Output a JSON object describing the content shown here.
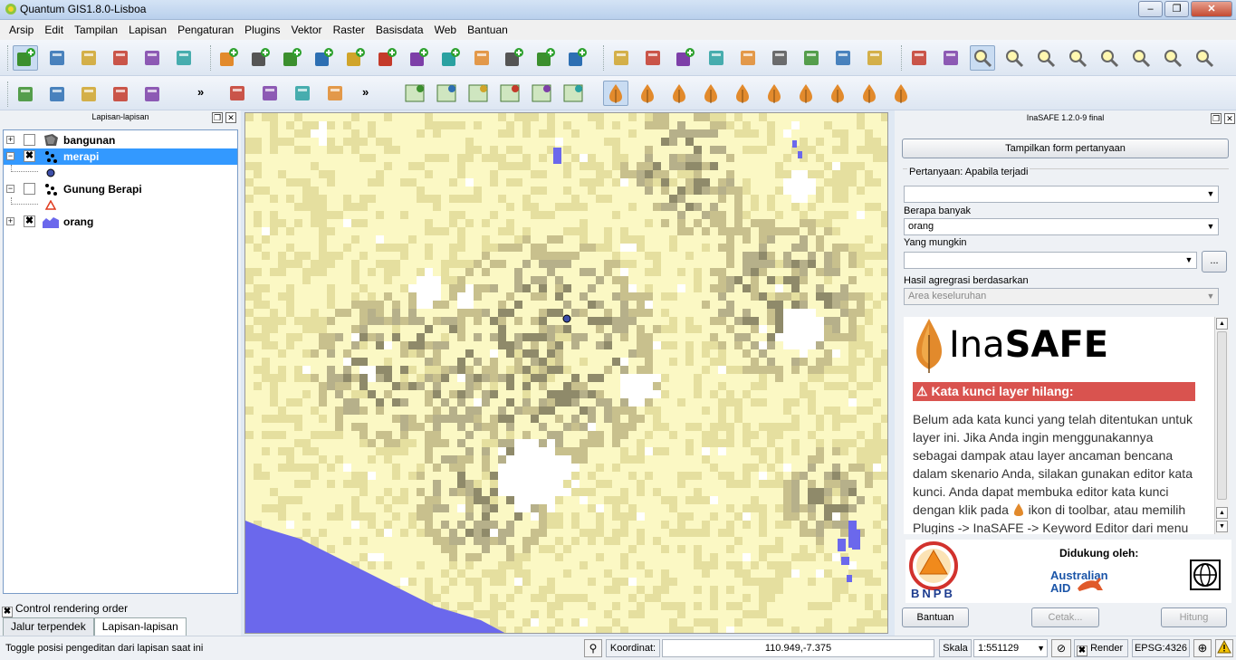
{
  "window": {
    "title": "Quantum GIS1.8.0-Lisboa",
    "min": "–",
    "max": "❐",
    "close": "✕"
  },
  "menu": [
    "Arsip",
    "Edit",
    "Tampilan",
    "Lapisan",
    "Pengaturan",
    "Plugins",
    "Vektor",
    "Raster",
    "Basisdata",
    "Web",
    "Bantuan"
  ],
  "toolbar": {
    "overflow": "»",
    "row1_icons": [
      "new-project-icon",
      "open-project-icon",
      "save-project-icon",
      "save-as-icon",
      "print-composer-icon",
      "print-icon",
      "add-vector-layer-icon",
      "add-raster-layer-icon",
      "add-postgis-layer-icon",
      "add-spatialite-layer-icon",
      "add-mssql-layer-icon",
      "add-wms-layer-icon",
      "add-wfs-layer-icon",
      "new-shapefile-icon",
      "remove-layer-icon",
      "add-wcs-layer-icon",
      "new-spatialite-icon",
      "add-csv-layer-icon",
      "toggle-editing-icon",
      "save-edits-icon",
      "add-feature-icon",
      "move-feature-icon",
      "node-tool-icon",
      "delete-selected-icon",
      "cut-features-icon",
      "copy-features-icon",
      "paste-features-icon",
      "pan-icon",
      "pan-to-selection-icon",
      "zoom-in-icon",
      "zoom-out-icon",
      "zoom-actual-icon",
      "zoom-full-icon",
      "zoom-to-selection-icon",
      "zoom-to-layer-icon",
      "zoom-last-icon",
      "zoom-next-icon"
    ],
    "row2_icons": [
      "identify-icon",
      "actions-icon",
      "select-icon",
      "deselect-icon",
      "attribute-table-icon",
      "georeferencer-icon",
      "mvd-icon",
      "raster-calc-icon",
      "elephant-icon",
      "openlayers-1-icon",
      "openlayers-2-icon",
      "openlayers-3-icon",
      "openlayers-4-icon",
      "openlayers-5-icon",
      "openlayers-6-icon",
      "inasafe-dock-icon",
      "keyword-editor-icon",
      "impact-function-icon",
      "minimum-needs-icon",
      "shakemap-icon",
      "population-icon",
      "converter-icon",
      "options-icon",
      "batch-icon",
      "save-scenario-icon"
    ]
  },
  "layers_panel": {
    "title": "Lapisan-lapisan",
    "layers": [
      {
        "name": "bangunan",
        "checked": "",
        "expander": "+"
      },
      {
        "name": "merapi",
        "checked": "✖",
        "expander": "−"
      },
      {
        "name": "Gunung Berapi",
        "checked": "",
        "expander": "−"
      },
      {
        "name": "orang",
        "checked": "✖",
        "expander": "+"
      }
    ],
    "control_rendering": "Control rendering order",
    "control_rendering_checked": "✖",
    "tabs": [
      "Jalur terpendek",
      "Lapisan-lapisan"
    ]
  },
  "inasafe": {
    "title": "InaSAFE 1.2.0-9 final",
    "show_question_form": "Tampilkan form pertanyaan",
    "question_label": "Pertanyaan: Apabila terjadi",
    "hazard_value": "",
    "how_many_label": "Berapa banyak",
    "exposure_value": "orang",
    "might_label": "Yang mungkin",
    "function_value": "",
    "ellipsis": "...",
    "aggregation_label": "Hasil agregrasi berdasarkan",
    "aggregation_value": "Area keseluruhan",
    "logo_ina": "Ina",
    "logo_safe": "SAFE",
    "warning_title": "⚠ Kata kunci layer hilang:",
    "warning_body_1": "Belum ada kata kunci yang telah ditentukan untuk layer ini. Jika Anda ingin menggunakannya sebagai dampak atau layer ancaman bencana dalam skenario Anda, silakan gunakan editor kata kunci. Anda dapat membuka editor kata kunci dengan klik pada",
    "warning_body_2": "ikon di toolbar, atau memilih Plugins ->",
    "warning_body_3": "InaSAFE -> Keyword Editor dari menu bar.",
    "supported_by": "Didukung oleh:",
    "bnpb": "BNPB",
    "aid_1": "Australian",
    "aid_2": "AID",
    "help_button": "Bantuan",
    "print_button": "Cetak...",
    "run_button": "Hitung"
  },
  "statusbar": {
    "message": "Toggle posisi pengeditan dari lapisan saat ini",
    "coord_label": "Koordinat:",
    "coord_value": "110.949,-7.375",
    "scale_label": "Skala",
    "scale_value": "1:551129",
    "render_label": "Render",
    "render_checked": "✖",
    "crs": "EPSG:4326"
  },
  "colors": {
    "map_background": "#fbf8c4",
    "map_dark": "#c8c08d",
    "map_mid": "#e5df9f",
    "water": "#6b68ec",
    "selection": "#3399ff",
    "warning": "#d9534f"
  }
}
